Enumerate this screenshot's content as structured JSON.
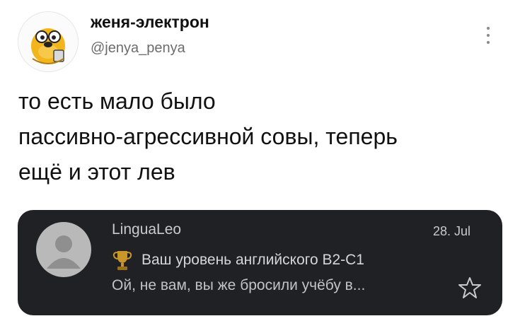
{
  "tweet": {
    "display_name": "женя-электрон",
    "handle": "@jenya_penya",
    "avatar_icon": "cartoon-dog-avatar",
    "more_icon": "more-options-icon",
    "text_lines": [
      "то есть мало было",
      "пассивно-агрессивной совы, теперь",
      "ещё и этот лев"
    ]
  },
  "email": {
    "sender": "LinguaLeo",
    "date": "28. Jul",
    "subject": "Ваш уровень английского B2-C1",
    "snippet": "Ой, не вам, вы же бросили учёбу в...",
    "avatar_icon": "default-person-avatar",
    "subject_icon": "trophy-icon",
    "star_icon": "star-outline-icon"
  },
  "colors": {
    "background": "#ffffff",
    "card_background": "#202124",
    "trophy": "#c9962a"
  }
}
